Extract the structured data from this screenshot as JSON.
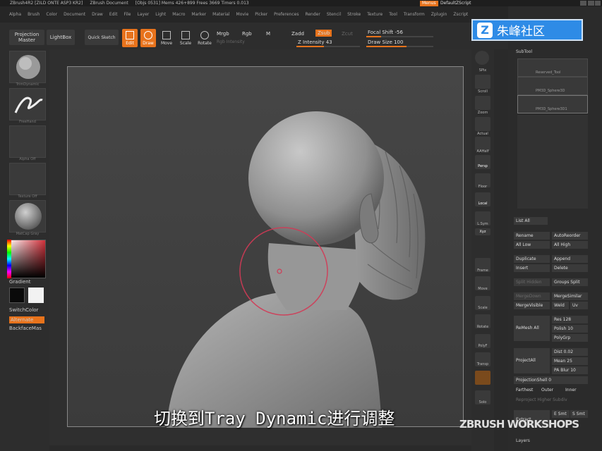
{
  "titlebar": {
    "app": "ZBrush4R2 [ZILD ONTE ASP3 KR2]",
    "doc": "ZBrush Document",
    "stats": "[Objs 0531] Mems 426+899 Frees 3669 Timers 0.013",
    "menus": "Menus",
    "script": "DefaultZScript"
  },
  "menubar": {
    "items": [
      "Alpha",
      "Brush",
      "Color",
      "Document",
      "Draw",
      "Edit",
      "File",
      "Layer",
      "Light",
      "Macro",
      "Marker",
      "Material",
      "Movie",
      "Picker",
      "Preferences",
      "Render",
      "Stencil",
      "Stroke",
      "Texture",
      "Tool",
      "Transform",
      "Zplugin",
      "Zscript"
    ]
  },
  "shelf": {
    "projection_master": "Projection Master",
    "lightbox": "LightBox",
    "quick_sketch": "Quick Sketch",
    "edit": "Edit",
    "draw": "Draw",
    "move": "Move",
    "scale": "Scale",
    "rotate": "Rotate",
    "mrgb": "Mrgb",
    "rgb": "Rgb",
    "m": "M",
    "rgb_intensity": "Rgb Intensity",
    "zadd": "Zadd",
    "zsub": "Zsub",
    "zcut": "Zcut",
    "z_intensity": "Z Intensity 43",
    "focal_shift": "Focal Shift -56",
    "draw_size": "Draw Size 100"
  },
  "lefttray": {
    "brush_label": "TrimDynamic",
    "stroke_label": "FreeHand",
    "alpha_label": "Alpha Off",
    "texture_label": "Texture Off",
    "material_label": "MatCap Gray",
    "gradient": "Gradient",
    "switchcolor": "SwitchColor",
    "alternate": "Alternate",
    "backfacemask": "BackfaceMas"
  },
  "rightshelf": {
    "items": [
      "SPix",
      "Scroll",
      "Zoom",
      "Actual",
      "AAHalf",
      "Persp",
      "Floor",
      "Local",
      "L.Sym",
      "Xyz",
      "Frame",
      "Move",
      "Scale",
      "Rotate",
      "PolyF",
      "Transp",
      "Solo"
    ]
  },
  "righttray": {
    "logo_text": "朱峰社区",
    "subtool_title": "SubTool",
    "subtools": [
      "Reserved_Tool",
      "PM3D_Sphere3D",
      "PM3D_Sphere3D1"
    ],
    "list_all": "List All",
    "rename": "Rename",
    "autoreorder": "AutoReorder",
    "all_low": "All Low",
    "all_high": "All High",
    "duplicate": "Duplicate",
    "append": "Append",
    "insert": "Insert",
    "delete": "Delete",
    "split_hidden": "Split Hidden",
    "groups_split": "Groups Split",
    "merge_down": "MergeDown",
    "merge_similar": "MergeSimilar",
    "merge_visible": "MergeVisible",
    "weld": "Weld",
    "uv": "Uv",
    "remesh_all": "ReMesh All",
    "res": "Res 128",
    "polish": "Polish 10",
    "polygrp": "PolyGrp",
    "project_all": "ProjectAll",
    "dist": "Dist 0.02",
    "mean": "Mean 25",
    "pa_blur": "PA Blur 10",
    "projection_shell": "ProjectionShell 0",
    "farthest": "Farthest",
    "outer": "Outer",
    "inner": "Inner",
    "reproject_higher": "Reproject Higher Subdiv",
    "extract": "Extract",
    "e_smt": "E Smt",
    "s_smt": "S Smt",
    "layers": "Layers"
  },
  "subtitle": "切换到Tray Dynamic进行调整",
  "watermark": "ZBRUSH WORKSHOPS",
  "colors": {
    "accent": "#e8731c",
    "logo_blue": "#2e8be6",
    "brush_ring": "#d23a55"
  }
}
